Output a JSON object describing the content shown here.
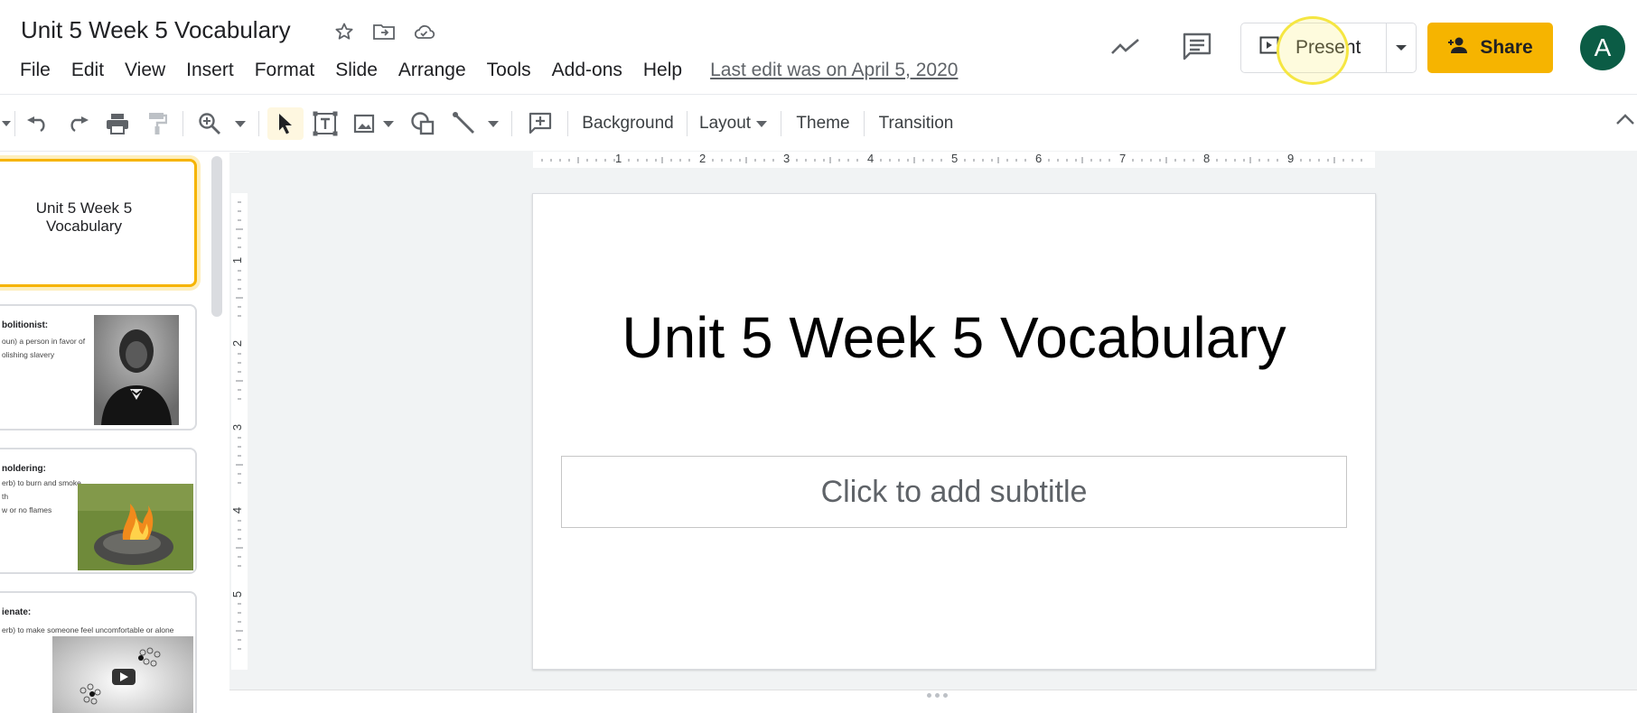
{
  "document": {
    "title": "Unit 5 Week 5 Vocabulary",
    "last_edit": "Last edit was on April 5, 2020"
  },
  "menu": [
    "File",
    "Edit",
    "View",
    "Insert",
    "Format",
    "Slide",
    "Arrange",
    "Tools",
    "Add-ons",
    "Help"
  ],
  "header_actions": {
    "present_label": "Present",
    "share_label": "Share",
    "avatar_initial": "A"
  },
  "toolbar": {
    "background_label": "Background",
    "layout_label": "Layout",
    "theme_label": "Theme",
    "transition_label": "Transition"
  },
  "filmstrip": {
    "slide1_title": "Unit 5 Week 5 Vocabulary",
    "slide2_term": "bolitionist:",
    "slide2_def": "oun) a person in favor of\nolishing slavery",
    "slide3_term": "noldering:",
    "slide3_def": "erb) to burn and smoke\nth\nw or no flames",
    "slide4_term": "ienate:",
    "slide4_def": "erb) to make someone feel uncomfortable or alone"
  },
  "ruler": {
    "horizontal": [
      "1",
      "2",
      "3",
      "4",
      "5",
      "6",
      "7",
      "8",
      "9"
    ],
    "vertical": [
      "1",
      "2",
      "3",
      "4",
      "5"
    ]
  },
  "slide": {
    "title": "Unit 5 Week 5 Vocabulary",
    "subtitle_placeholder": "Click to add subtitle"
  },
  "colors": {
    "share_button": "#f6b400",
    "avatar": "#0b5c45",
    "active_thumb_border": "#f6b400"
  }
}
